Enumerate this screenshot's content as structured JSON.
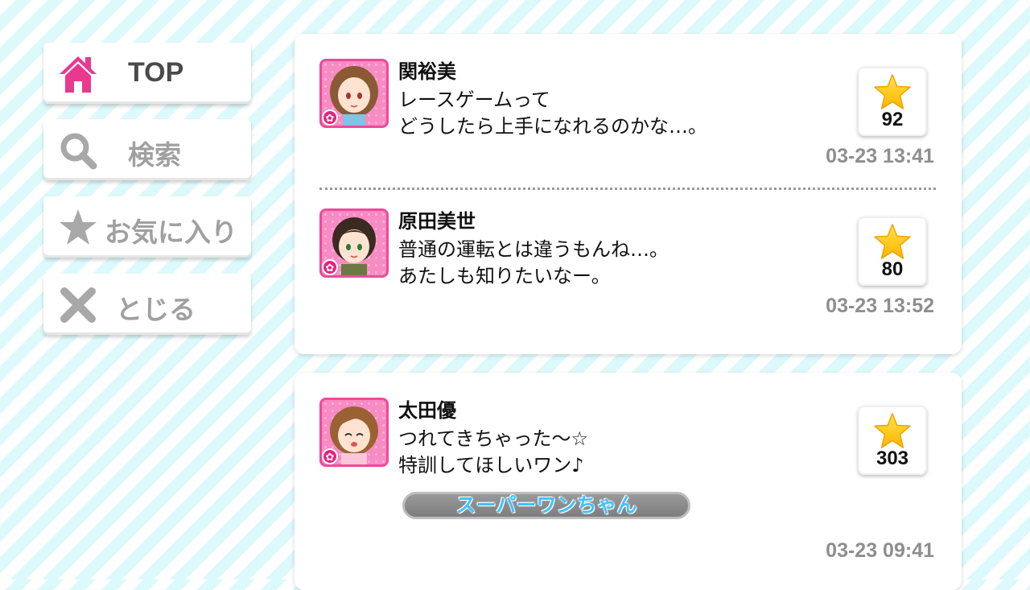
{
  "nav": {
    "top_label": "TOP",
    "search_label": "検索",
    "favorites_label": "お気に入り",
    "close_label": "とじる"
  },
  "colors": {
    "accent_pink": "#e8398f",
    "icon_gray": "#a0a0a0",
    "star_yellow": "#ffcc00",
    "tag_text": "#3fc1ff"
  },
  "threads": [
    {
      "posts": [
        {
          "name": "関裕美",
          "lines": [
            "レースゲームって",
            "どうしたら上手になれるのかな…。"
          ],
          "stars": "92",
          "time": "03-23 13:41"
        },
        {
          "name": "原田美世",
          "lines": [
            "普通の運転とは違うもんね…。",
            "あたしも知りたいなー。"
          ],
          "stars": "80",
          "time": "03-23 13:52"
        }
      ]
    },
    {
      "posts": [
        {
          "name": "太田優",
          "lines": [
            "つれてきちゃった〜☆",
            "特訓してほしいワン♪"
          ],
          "stars": "303",
          "tag": "スーパーワンちゃん",
          "time": "03-23 09:41"
        }
      ]
    }
  ]
}
